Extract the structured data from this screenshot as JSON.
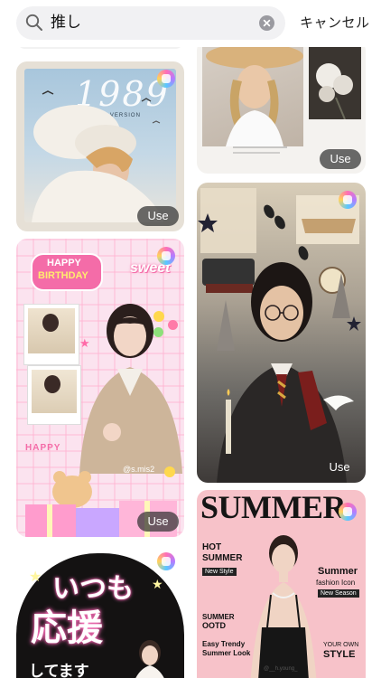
{
  "search": {
    "query": "推し",
    "cancel_label": "キャンセル"
  },
  "cards": {
    "album_1989": {
      "title": "1989",
      "subtitle": "TAYLOR'S VERSION",
      "use_label": "Use"
    },
    "hat_portrait": {
      "use_label": "Use"
    },
    "birthday": {
      "happy_birthday_1": "HAPPY",
      "happy_birthday_2": "BIRTHDAY",
      "sweet": "sweet",
      "happy": "HAPPY",
      "handle": "@s.mis2",
      "use_label": "Use"
    },
    "wizard": {
      "use_label": "Use"
    },
    "summer_magazine": {
      "title": "SUMMER",
      "hot_summer": "HOT SUMMER",
      "new_style": "New Style",
      "summer_fashion_1": "Summer",
      "summer_fashion_2": "fashion Icon",
      "new_season": "New Season",
      "summer_ootd_1": "SUMMER",
      "summer_ootd_2": "OOTD",
      "easy_trendy_1": "Easy Trendy",
      "easy_trendy_2": "Summer Look",
      "your_own_1": "YOUR OWN",
      "your_own_2": "STYLE",
      "handle": "@__h.young_"
    },
    "fan_sign": {
      "line1": "いつも",
      "line2": "応援",
      "line3": "してます"
    }
  }
}
